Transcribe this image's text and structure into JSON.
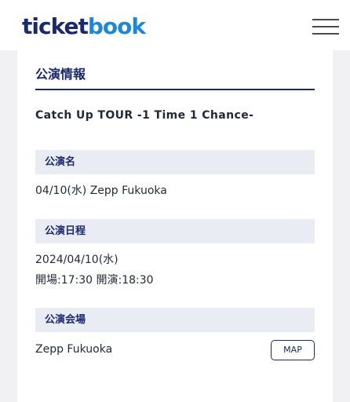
{
  "header": {
    "logo_part1": "ticket",
    "logo_part2": "book"
  },
  "section": {
    "title": "公演情報"
  },
  "event": {
    "title": "Catch Up TOUR -1 Time 1 Chance-"
  },
  "fields": {
    "name_label": "公演名",
    "name_value": "04/10(水) Zepp Fukuoka",
    "date_label": "公演日程",
    "date_value": "2024/04/10(水)",
    "time_value": "開場:17:30 開演:18:30",
    "venue_label": "公演会場",
    "venue_value": "Zepp Fukuoka"
  },
  "buttons": {
    "map_label": "MAP"
  },
  "colors": {
    "navy": "#1a2a6c",
    "blue": "#1e88d6",
    "label_bg": "#e9ecf3",
    "page_bg": "#f1f1f3"
  }
}
